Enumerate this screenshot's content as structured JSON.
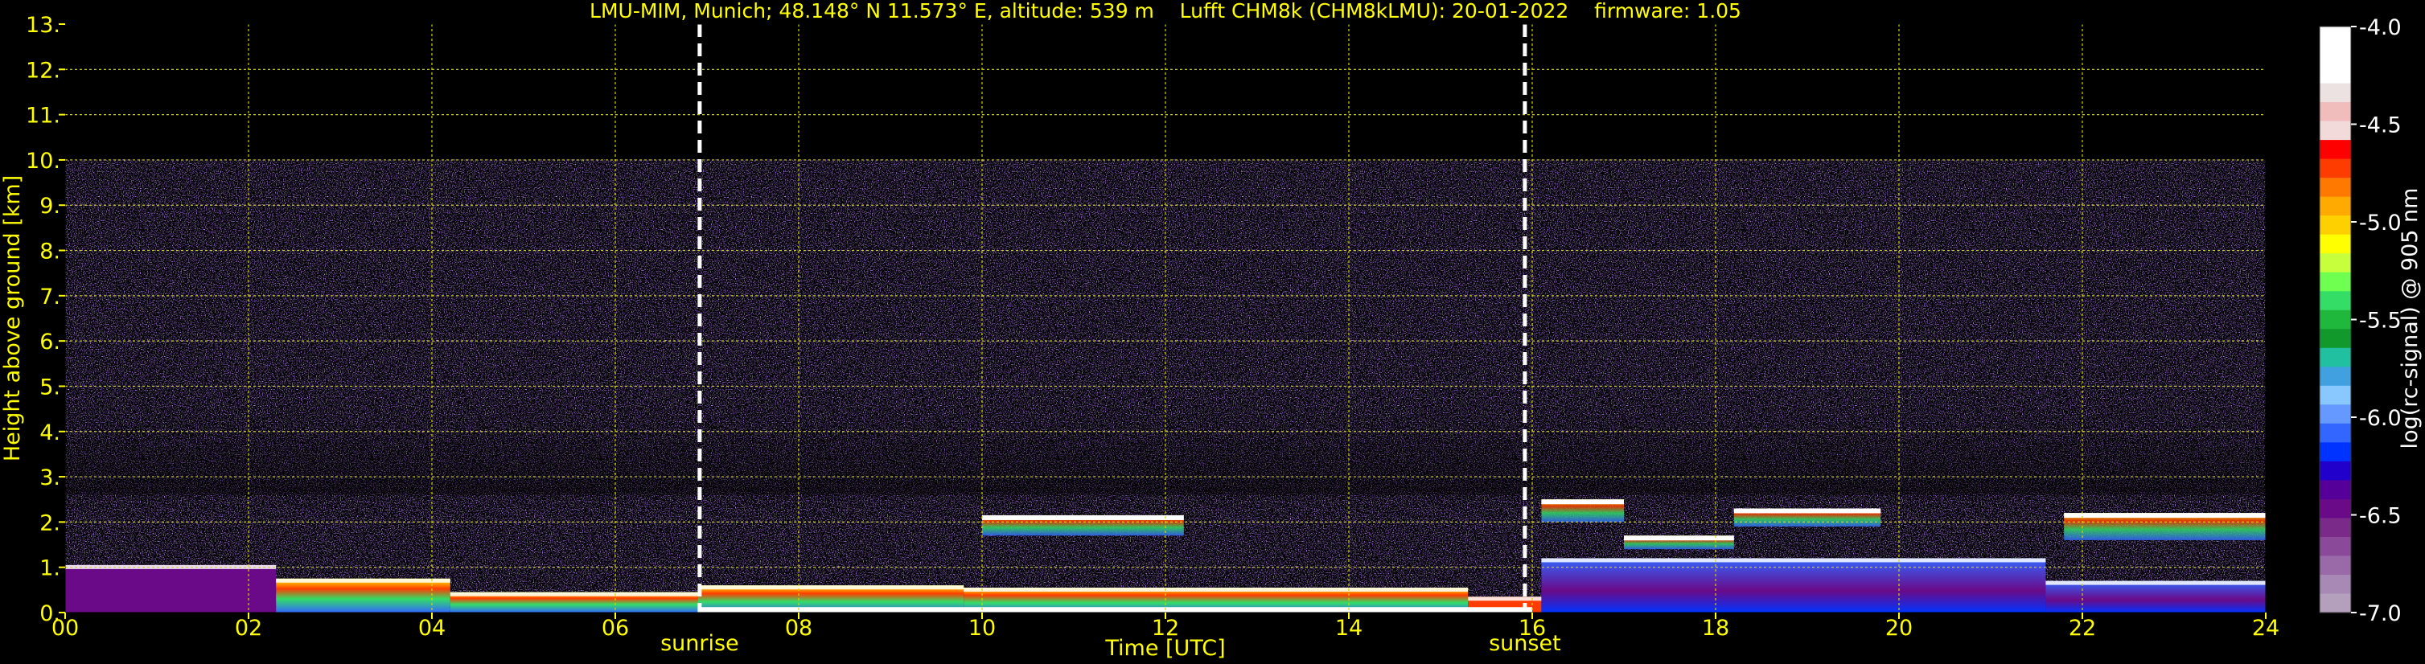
{
  "chart_data": {
    "type": "heatmap",
    "title": "LMU-MIM, Munich; 48.148° N 11.573° E, altitude: 539 m    Lufft CHM8k (CHM8kLMU): 20-01-2022    firmware: 1.05",
    "xlabel": "Time [UTC]",
    "ylabel": "Height above ground [km]",
    "xlim": [
      0,
      24
    ],
    "ylim": [
      0,
      13
    ],
    "x_ticks": [
      "00",
      "02",
      "04",
      "06",
      "08",
      "10",
      "12",
      "14",
      "16",
      "18",
      "20",
      "22",
      "24"
    ],
    "x_tick_values": [
      0,
      2,
      4,
      6,
      8,
      10,
      12,
      14,
      16,
      18,
      20,
      22,
      24
    ],
    "y_ticks": [
      "0.",
      "1.",
      "2.",
      "3.",
      "4.",
      "5.",
      "6.",
      "7.",
      "8.",
      "9.",
      "10.",
      "11.",
      "12.",
      "13."
    ],
    "y_tick_values": [
      0,
      1,
      2,
      3,
      4,
      5,
      6,
      7,
      8,
      9,
      10,
      11,
      12,
      13
    ],
    "grid": true,
    "annotations": [
      {
        "label": "sunrise",
        "x": 6.92
      },
      {
        "label": "sunset",
        "x": 15.92
      }
    ],
    "data_top_km": 10,
    "colorbar": {
      "label": "log(rc-signal) @ 905 nm",
      "range": [
        -7.0,
        -4.0
      ],
      "ticks": [
        "-4.0",
        "-4.5",
        "-5.0",
        "-5.5",
        "-6.0",
        "-6.5",
        "-7.0"
      ],
      "tick_values": [
        -4.0,
        -4.5,
        -5.0,
        -5.5,
        -6.0,
        -6.5,
        -7.0
      ],
      "colors_top_to_bottom": [
        "#ffffff",
        "#ffffff",
        "#ffffff",
        "#ece2e2",
        "#f0bcbc",
        "#f3dada",
        "#ff0000",
        "#ff3c00",
        "#ff7800",
        "#ffaa00",
        "#ffd000",
        "#ffff00",
        "#c8ff3c",
        "#6eff50",
        "#33dd66",
        "#1fb83c",
        "#11992c",
        "#20c0a0",
        "#40a0e0",
        "#88c8ff",
        "#6699ff",
        "#3366ff",
        "#0033ff",
        "#2200cc",
        "#550099",
        "#6a0a88",
        "#7a2a88",
        "#8a4a99",
        "#9a6aa8",
        "#a888b4",
        "#b4a0bc"
      ]
    },
    "cloud_layers": [
      {
        "t0": 10.0,
        "t1": 12.2,
        "base_km": 1.7,
        "top_km": 2.15
      },
      {
        "t0": 16.1,
        "t1": 17.0,
        "base_km": 2.0,
        "top_km": 2.5
      },
      {
        "t0": 17.0,
        "t1": 18.2,
        "base_km": 1.4,
        "top_km": 1.7
      },
      {
        "t0": 18.2,
        "t1": 19.8,
        "base_km": 1.9,
        "top_km": 2.3
      },
      {
        "t0": 21.8,
        "t1": 24.0,
        "base_km": 1.6,
        "top_km": 2.2
      }
    ]
  }
}
